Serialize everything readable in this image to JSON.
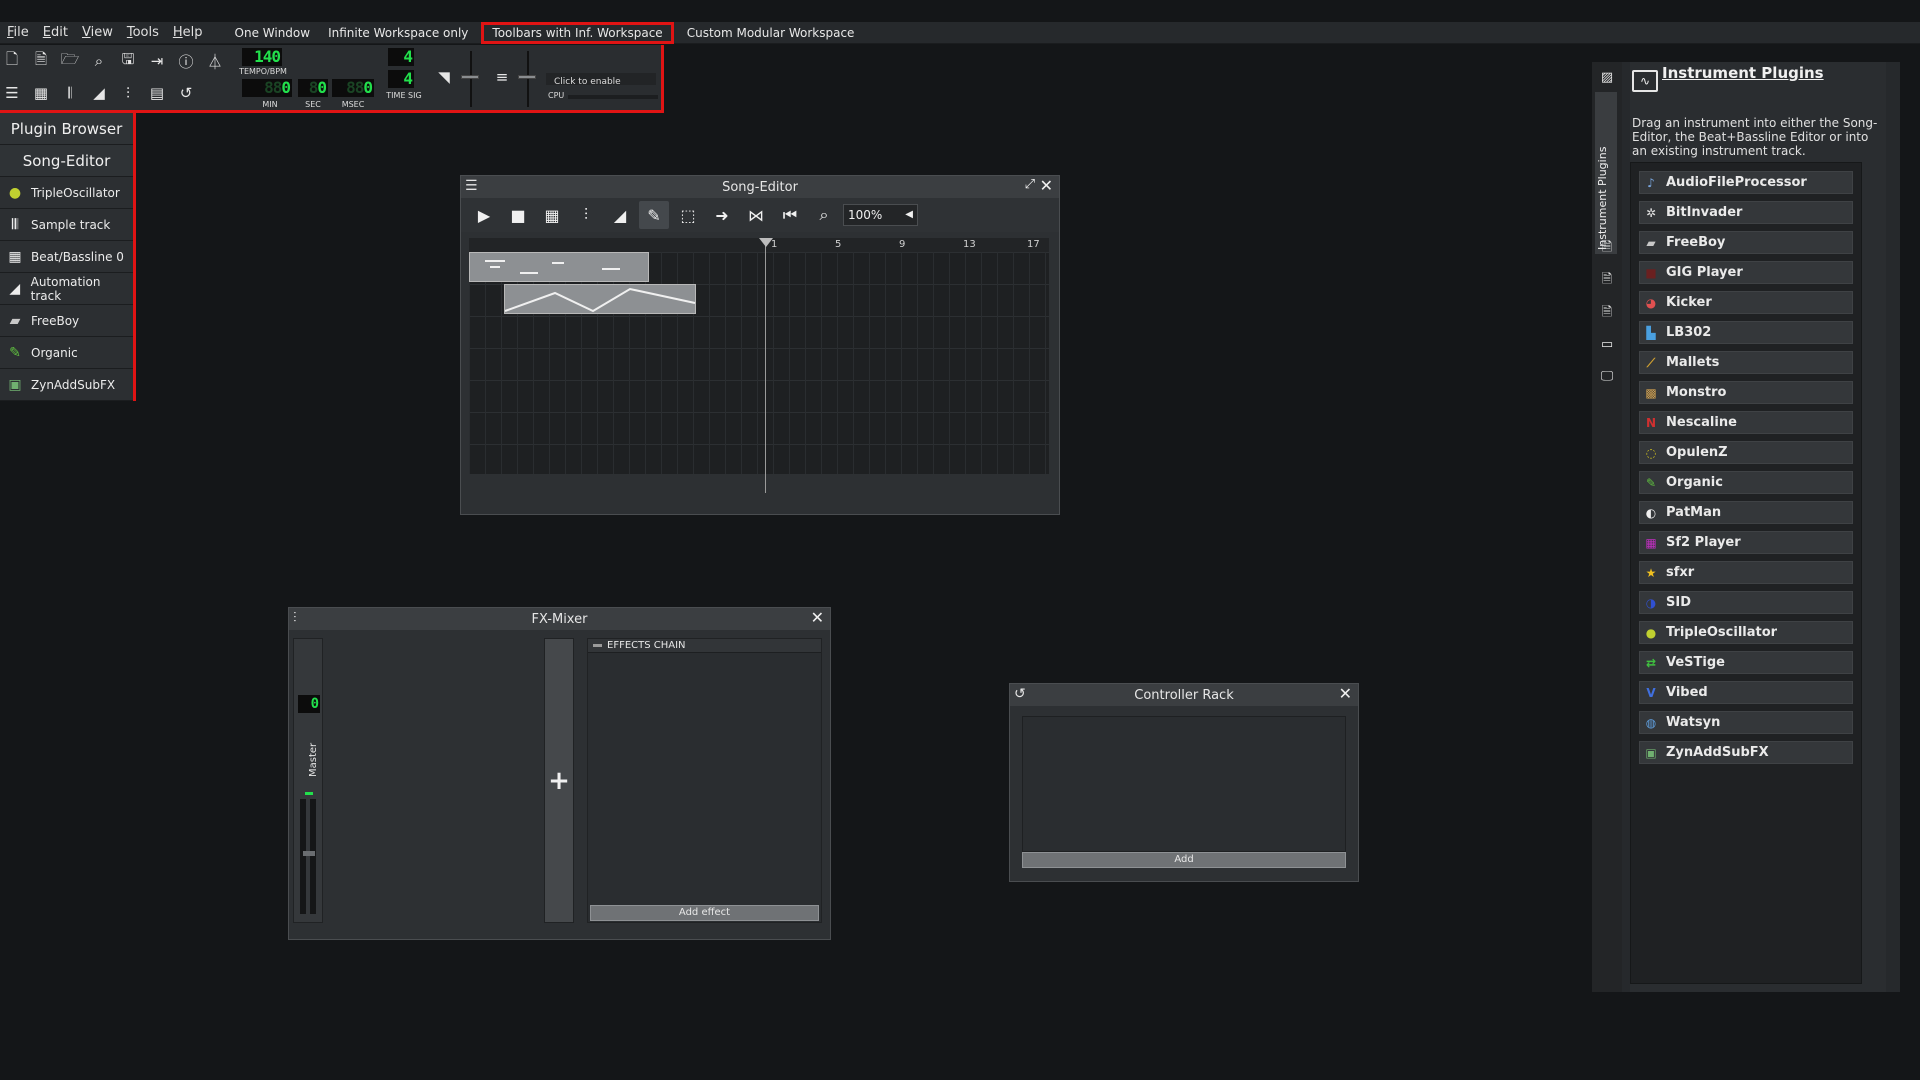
{
  "menubar": {
    "items": [
      "File",
      "Edit",
      "View",
      "Tools",
      "Help"
    ],
    "modes": [
      "One Window",
      "Infinite Workspace only",
      "Toolbars with Inf. Workspace",
      "Custom Modular Workspace"
    ],
    "selected_mode": "Toolbars with Inf. Workspace"
  },
  "toolbar": {
    "tempo_value": "140",
    "tempo_label": "TEMPO/BPM",
    "min_value": "0",
    "min_label": "MIN",
    "sec_value": "0",
    "sec_label": "SEC",
    "msec_value": "0",
    "msec_label": "MSEC",
    "timesig_num": "4",
    "timesig_den": "4",
    "timesig_label": "TIME SIG",
    "cpu_hint": "Click to enable",
    "cpu_label": "CPU"
  },
  "sidebar": {
    "plugin_browser": "Plugin Browser",
    "song_editor": "Song-Editor",
    "tracks": [
      {
        "label": "TripleOscillator",
        "icon": "triple-oscillator-icon"
      },
      {
        "label": "Sample track",
        "icon": "waveform-icon"
      },
      {
        "label": "Beat/Bassline 0",
        "icon": "beat-grid-icon"
      },
      {
        "label": "Automation track",
        "icon": "automation-ramp-icon"
      },
      {
        "label": "FreeBoy",
        "icon": "gameboy-icon"
      },
      {
        "label": "Organic",
        "icon": "organic-icon"
      },
      {
        "label": "ZynAddSubFX",
        "icon": "zyn-icon"
      }
    ]
  },
  "song_editor": {
    "title": "Song-Editor",
    "zoom": "100%",
    "ruler": [
      "1",
      "5",
      "9",
      "13",
      "17"
    ]
  },
  "fx_mixer": {
    "title": "FX-Mixer",
    "master_label": "Master",
    "master_value": "0",
    "effects_chain_label": "EFFECTS CHAIN",
    "add_effect": "Add effect"
  },
  "controller_rack": {
    "title": "Controller Rack",
    "add": "Add"
  },
  "instrument_plugins": {
    "tab_label": "Instrument Plugins",
    "title": "Instrument Plugins",
    "description": "Drag an instrument into either the Song-Editor, the Beat+Bassline Editor or into an existing instrument track.",
    "plugins": [
      {
        "name": "AudioFileProcessor",
        "icon": "audio-file-icon",
        "color": "#7aa7e0"
      },
      {
        "name": "BitInvader",
        "icon": "bitinvader-icon",
        "color": "#e0e0e0"
      },
      {
        "name": "FreeBoy",
        "icon": "freeboy-icon",
        "color": "#c8c8c8"
      },
      {
        "name": "GIG Player",
        "icon": "gig-player-icon",
        "color": "#6a2020"
      },
      {
        "name": "Kicker",
        "icon": "kicker-icon",
        "color": "#e05050"
      },
      {
        "name": "LB302",
        "icon": "lb302-icon",
        "color": "#4aa0e0"
      },
      {
        "name": "Mallets",
        "icon": "mallets-icon",
        "color": "#d0a030"
      },
      {
        "name": "Monstro",
        "icon": "monstro-icon",
        "color": "#d0a050"
      },
      {
        "name": "Nescaline",
        "icon": "nescaline-icon",
        "color": "#d03030"
      },
      {
        "name": "OpulenZ",
        "icon": "opulenz-icon",
        "color": "#d0c020"
      },
      {
        "name": "Organic",
        "icon": "organic-icon",
        "color": "#60c040"
      },
      {
        "name": "PatMan",
        "icon": "patman-icon",
        "color": "#f0f0f0"
      },
      {
        "name": "Sf2 Player",
        "icon": "sf2-player-icon",
        "color": "#c030c0"
      },
      {
        "name": "sfxr",
        "icon": "sfxr-icon",
        "color": "#f0c020"
      },
      {
        "name": "SID",
        "icon": "sid-icon",
        "color": "#3050d0"
      },
      {
        "name": "TripleOscillator",
        "icon": "triple-oscillator-icon",
        "color": "#c0d030"
      },
      {
        "name": "VeSTige",
        "icon": "vestige-icon",
        "color": "#40c040"
      },
      {
        "name": "Vibed",
        "icon": "vibed-icon",
        "color": "#4070e0"
      },
      {
        "name": "Watsyn",
        "icon": "watsyn-icon",
        "color": "#60a0e0"
      },
      {
        "name": "ZynAddSubFX",
        "icon": "zynaddsubfx-icon",
        "color": "#70b070"
      }
    ]
  },
  "colors": {
    "highlight": "#e01414",
    "lcd_green": "#22e04c",
    "background": "#141618"
  }
}
